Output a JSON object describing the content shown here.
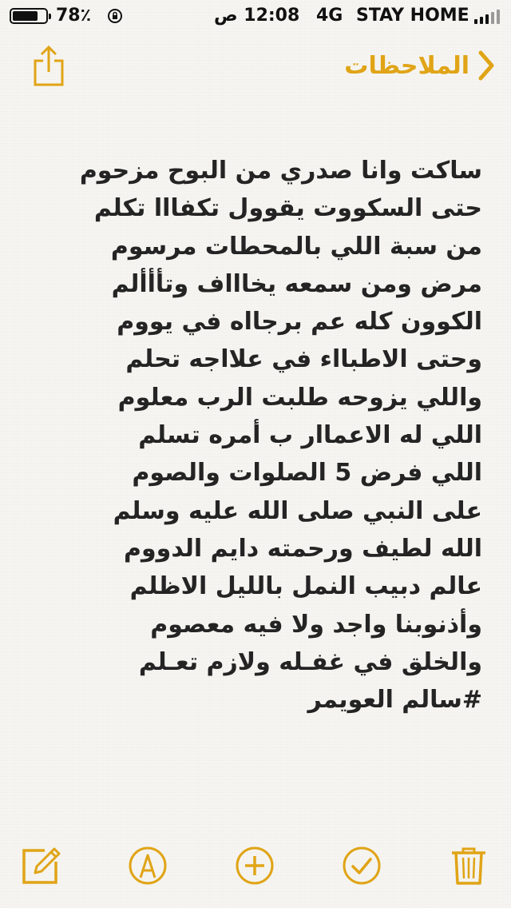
{
  "status_bar": {
    "battery_percent": "78٪",
    "battery_level": 0.78,
    "time": "12:08 ص",
    "network": "4G",
    "carrier": "STAY HOME"
  },
  "nav": {
    "back_label": "الملاحظات",
    "share_icon": "share-icon",
    "back_icon": "chevron-left-icon"
  },
  "note": {
    "lines": [
      "ساكت وانا صدري من البوح مزحوم",
      "حتى السكووت يقوول  تكفااا  تكلم",
      "من سبة اللي بالمحطات مرسوم",
      "مرض ومن سمعه يخاااف وتأأألم",
      "الكوون كله عم برجااه في يووم",
      "وحتى الاطبااء في علااجه تحلم",
      "واللي يزوحه طلبت الرب معلوم",
      "اللي له الاعماار  ب أمره  تسلم",
      "اللي فرض 5 الصلوات والصوم",
      "على النبي صلى الله عليه وسلم",
      "الله لطيف ورحمته دايم الدووم",
      "عالم دبيب النمل بالليل الاظلم",
      "وأذنوبنا واجد ولا فيه معصوم",
      "والخلق في غفـله ولازم  تعـلم",
      "#سالم العويمر"
    ]
  },
  "toolbar": {
    "compose_icon": "compose-icon",
    "markup_icon": "markup-pen-icon",
    "add_icon": "plus-circle-icon",
    "checklist_icon": "checkmark-circle-icon",
    "delete_icon": "trash-icon"
  },
  "colors": {
    "accent": "#e0a416",
    "background": "#f6f5f1",
    "text": "#242424"
  }
}
